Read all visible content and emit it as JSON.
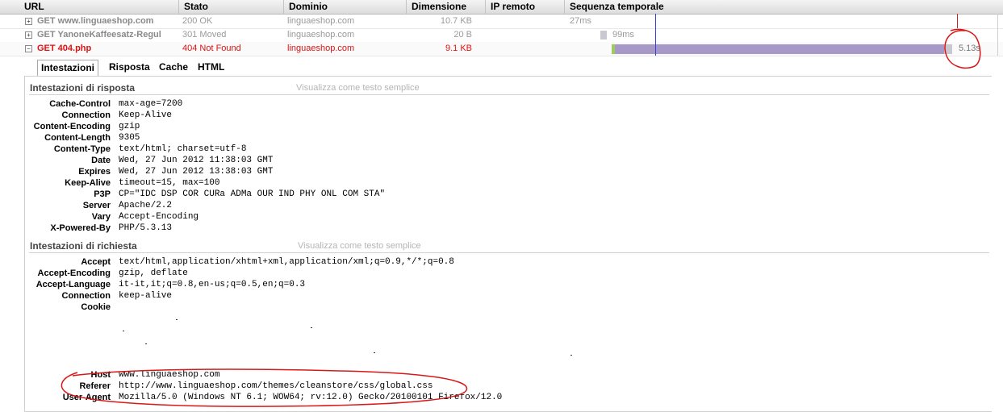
{
  "columns": {
    "url": "URL",
    "stato": "Stato",
    "dominio": "Dominio",
    "dimensione": "Dimensione",
    "ip_remoto": "IP remoto",
    "sequenza": "Sequenza temporale"
  },
  "requests": [
    {
      "url": "GET www.linguaeshop.com",
      "stato": "200 OK",
      "dominio": "linguaeshop.com",
      "dimensione": "10.7 KB",
      "timing": "27ms",
      "toggle": "+"
    },
    {
      "url": "GET YanoneKaffeesatz-Regul",
      "stato": "301 Moved",
      "dominio": "linguaeshop.com",
      "dimensione": "20 B",
      "timing": "99ms",
      "toggle": "+"
    },
    {
      "url": "GET 404.php",
      "stato": "404 Not Found",
      "dominio": "linguaeshop.com",
      "dimensione": "9.1 KB",
      "timing": "5.13s",
      "toggle": "−"
    }
  ],
  "tabs": [
    "Intestazioni",
    "Risposta",
    "Cache",
    "HTML"
  ],
  "response_section": {
    "title": "Intestazioni di risposta",
    "link": "Visualizza come testo semplice",
    "headers": [
      {
        "name": "Cache-Control",
        "value": "max-age=7200"
      },
      {
        "name": "Connection",
        "value": "Keep-Alive"
      },
      {
        "name": "Content-Encoding",
        "value": "gzip"
      },
      {
        "name": "Content-Length",
        "value": "9305"
      },
      {
        "name": "Content-Type",
        "value": "text/html; charset=utf-8"
      },
      {
        "name": "Date",
        "value": "Wed, 27 Jun 2012 11:38:03 GMT"
      },
      {
        "name": "Expires",
        "value": "Wed, 27 Jun 2012 13:38:03 GMT"
      },
      {
        "name": "Keep-Alive",
        "value": "timeout=15, max=100"
      },
      {
        "name": "P3P",
        "value": "CP=\"IDC DSP COR CURa ADMa OUR IND PHY ONL COM STA\""
      },
      {
        "name": "Server",
        "value": "Apache/2.2"
      },
      {
        "name": "Vary",
        "value": "Accept-Encoding"
      },
      {
        "name": "X-Powered-By",
        "value": "PHP/5.3.13"
      }
    ]
  },
  "request_section": {
    "title": "Intestazioni di richiesta",
    "link": "Visualizza come testo semplice",
    "headers": [
      {
        "name": "Accept",
        "value": "text/html,application/xhtml+xml,application/xml;q=0.9,*/*;q=0.8"
      },
      {
        "name": "Accept-Encoding",
        "value": "gzip, deflate"
      },
      {
        "name": "Accept-Language",
        "value": "it-it,it;q=0.8,en-us;q=0.5,en;q=0.3"
      },
      {
        "name": "Connection",
        "value": "keep-alive"
      },
      {
        "name": "Cookie",
        "value": ""
      }
    ],
    "tail_headers": [
      {
        "name": "Host",
        "value": "www.linguaeshop.com"
      },
      {
        "name": "Referer",
        "value": "http://www.linguaeshop.com/themes/cleanstore/css/global.css"
      },
      {
        "name": "User-Agent",
        "value": "Mozilla/5.0 (Windows NT 6.1; WOW64; rv:12.0) Gecko/20100101 Firefox/12.0"
      }
    ]
  },
  "colors": {
    "error_red": "#e01010",
    "timeline_bar": "#a898c8",
    "annotation_red": "#d81818"
  }
}
